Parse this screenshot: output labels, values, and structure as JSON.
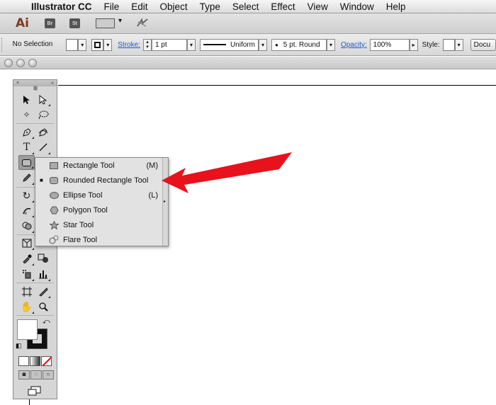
{
  "menubar": {
    "app_name": "Illustrator CC",
    "items": [
      "File",
      "Edit",
      "Object",
      "Type",
      "Select",
      "Effect",
      "View",
      "Window",
      "Help"
    ]
  },
  "appbar": {
    "logo": "Ai",
    "bridge": "Br",
    "stock": "St"
  },
  "controlbar": {
    "selection": "No Selection",
    "stroke_label": "Stroke:",
    "stroke_weight": "1 pt",
    "profile": "Uniform",
    "brush": "5 pt. Round",
    "opacity_label": "Opacity:",
    "opacity": "100%",
    "style_label": "Style:",
    "doc_button": "Docu"
  },
  "tools_panel": {
    "close": "×",
    "collapse": "«"
  },
  "flyout": {
    "items": [
      {
        "label": "Rectangle Tool",
        "shortcut": "(M)",
        "icon": "rectangle-icon",
        "selected": false
      },
      {
        "label": "Rounded Rectangle Tool",
        "shortcut": "",
        "icon": "rounded-rectangle-icon",
        "selected": true
      },
      {
        "label": "Ellipse Tool",
        "shortcut": "(L)",
        "icon": "ellipse-icon",
        "selected": false
      },
      {
        "label": "Polygon Tool",
        "shortcut": "",
        "icon": "polygon-icon",
        "selected": false
      },
      {
        "label": "Star Tool",
        "shortcut": "",
        "icon": "star-icon",
        "selected": false
      },
      {
        "label": "Flare Tool",
        "shortcut": "",
        "icon": "flare-icon",
        "selected": false
      }
    ]
  },
  "colors": {
    "annotation_arrow": "#e8121c",
    "link_blue": "#2456c7"
  }
}
